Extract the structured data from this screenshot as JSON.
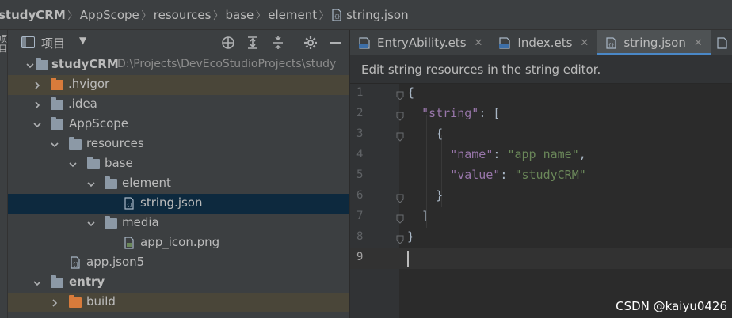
{
  "breadcrumb": {
    "items": [
      "studyCRM",
      "AppScope",
      "resources",
      "base",
      "element",
      "string.json"
    ]
  },
  "left_strip": {
    "label": "项目"
  },
  "project_panel": {
    "title": "项目",
    "tree": [
      {
        "label": "studyCRM",
        "path": "D:\\Projects\\DevEcoStudioProjects\\study",
        "bold": true,
        "type": "module"
      },
      {
        "label": ".hvigor",
        "type": "folder-orange"
      },
      {
        "label": ".idea",
        "type": "folder"
      },
      {
        "label": "AppScope",
        "type": "module"
      },
      {
        "label": "resources",
        "type": "folder"
      },
      {
        "label": "base",
        "type": "folder"
      },
      {
        "label": "element",
        "type": "folder"
      },
      {
        "label": "string.json",
        "type": "json"
      },
      {
        "label": "media",
        "type": "folder"
      },
      {
        "label": "app_icon.png",
        "type": "image"
      },
      {
        "label": "app.json5",
        "type": "json"
      },
      {
        "label": "entry",
        "bold": true,
        "type": "module"
      },
      {
        "label": "build",
        "type": "folder-orange"
      }
    ]
  },
  "tabs": [
    {
      "label": "EntryAbility.ets",
      "icon": "ets-file-icon",
      "close": "✕"
    },
    {
      "label": "Index.ets",
      "icon": "ets-file-icon",
      "close": "✕"
    },
    {
      "label": "string.json",
      "icon": "json-file-icon",
      "close": "✕",
      "active": true
    }
  ],
  "banner": {
    "text": "Edit string resources in the string editor."
  },
  "editor": {
    "lines": [
      {
        "num": "1",
        "tokens": [
          [
            "p",
            "{"
          ]
        ]
      },
      {
        "num": "2",
        "tokens": [
          [
            "p",
            "  "
          ],
          [
            "k",
            "\"string\""
          ],
          [
            "p",
            ": ["
          ]
        ]
      },
      {
        "num": "3",
        "tokens": [
          [
            "p",
            "    {"
          ]
        ]
      },
      {
        "num": "4",
        "tokens": [
          [
            "p",
            "      "
          ],
          [
            "k",
            "\"name\""
          ],
          [
            "p",
            ": "
          ],
          [
            "s",
            "\"app_name\""
          ],
          [
            "p",
            ","
          ]
        ]
      },
      {
        "num": "5",
        "tokens": [
          [
            "p",
            "      "
          ],
          [
            "k",
            "\"value\""
          ],
          [
            "p",
            ": "
          ],
          [
            "s",
            "\"studyCRM\""
          ]
        ]
      },
      {
        "num": "6",
        "tokens": [
          [
            "p",
            "    }"
          ]
        ]
      },
      {
        "num": "7",
        "tokens": [
          [
            "p",
            "  ]"
          ]
        ]
      },
      {
        "num": "8",
        "tokens": [
          [
            "p",
            "}"
          ]
        ]
      },
      {
        "num": "9",
        "tokens": []
      }
    ],
    "current_line": "9"
  },
  "watermark": "CSDN @kaiyu0426",
  "colors": {
    "selection": "#0d293e",
    "excluded": "#4a4639",
    "accent": "#4a88c7",
    "json_key": "#9876aa",
    "json_string": "#6a8759"
  }
}
